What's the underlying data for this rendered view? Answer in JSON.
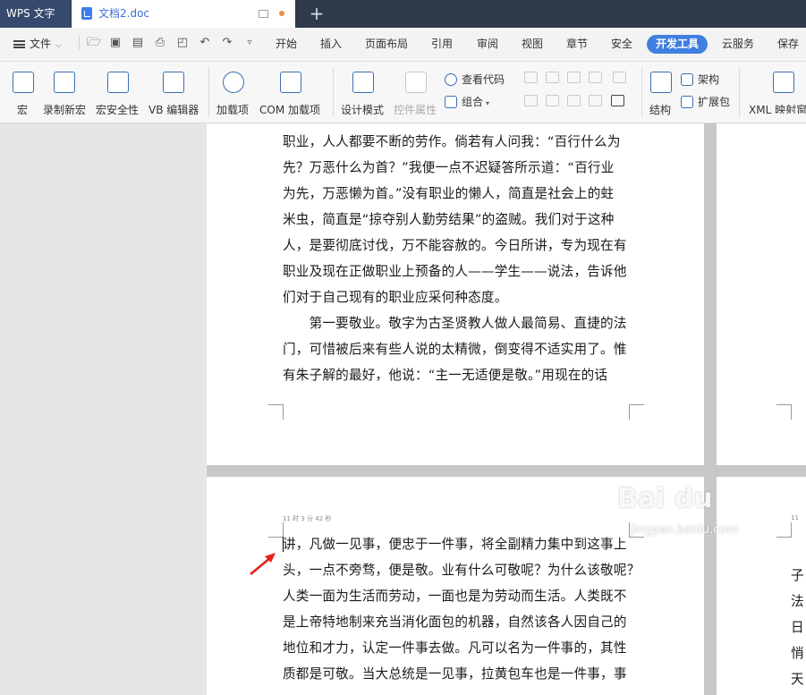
{
  "title_bar": {
    "app_name": "WPS 文字",
    "document_tab": "文档2.doc",
    "new_tab_symbol": "+",
    "unsaved_dot_color": "#f08c3a"
  },
  "menu": {
    "file_label": "文件",
    "items": [
      "开始",
      "插入",
      "页面布局",
      "引用",
      "审阅",
      "视图",
      "章节",
      "安全"
    ],
    "active_item": "开发工具",
    "after_items": [
      "云服务",
      "保存到"
    ],
    "accent_color": "#3f7fe0"
  },
  "quick_access_icons": [
    "open-folder-icon",
    "save-icon",
    "export-pdf-icon",
    "print-icon",
    "print-preview-icon",
    "undo-icon",
    "redo-icon",
    "more-icon"
  ],
  "ribbon": {
    "macro": "宏",
    "record_macro": "录制新宏",
    "macro_security": "宏安全性",
    "vb_editor": "VB 编辑器",
    "addins": "加载项",
    "com_addins": "COM 加载项",
    "design_mode": "设计模式",
    "control_properties": "控件属性",
    "view_code": "查看代码",
    "group": "组合",
    "structure": "结构",
    "schema": "架构",
    "expansion_pack": "扩展包",
    "xml_mapping": "XML 映射窗"
  },
  "document": {
    "page1_lines": [
      "职业，人人都要不断的劳作。倘若有人问我：“百行什么为",
      "先？万恶什么为首？”我便一点不迟疑答所示道：“百行业",
      "为先，万恶懒为首。”没有职业的懒人，简直是社会上的蛀",
      "米虫，简直是“掠夺别人勤劳结果”的盗贼。我们对于这种",
      "人，是要彻底讨伐，万不能容赦的。今日所讲，专为现在有",
      "职业及现在正做职业上预备的人——学生——说法，告诉他",
      "们对于自己现有的职业应采何种态度。",
      "　　第一要敬业。敬字为古圣贤教人做人最简易、直捷的法",
      "门，可惜被后来有些人说的太精微，倒变得不适实用了。惟",
      "有朱子解的最好，他说：“主一无适便是敬。”用现在的话"
    ],
    "header_note": "11 时 3 分 42 秒",
    "header_note_right": "11",
    "page2_lines": [
      "讲，凡做一见事，便忠于一件事，将全副精力集中到这事上",
      "头，一点不旁骛，便是敬。业有什么可敬呢？为什么该敬呢？",
      "人类一面为生活而劳动，一面也是为劳动而生活。人类既不",
      "是上帝特地制来充当消化面包的机器，自然该各人因自己的",
      "地位和才力，认定一件事去做。凡可以名为一件事的，其性",
      "质都是可敬。当大总统是一见事，拉黄包车也是一件事，事"
    ],
    "right_page_chars": [
      "子",
      "法",
      "日",
      "悄",
      "天"
    ]
  },
  "watermark": {
    "brand": "Bai du",
    "site": "jingyan.baidu.com"
  }
}
